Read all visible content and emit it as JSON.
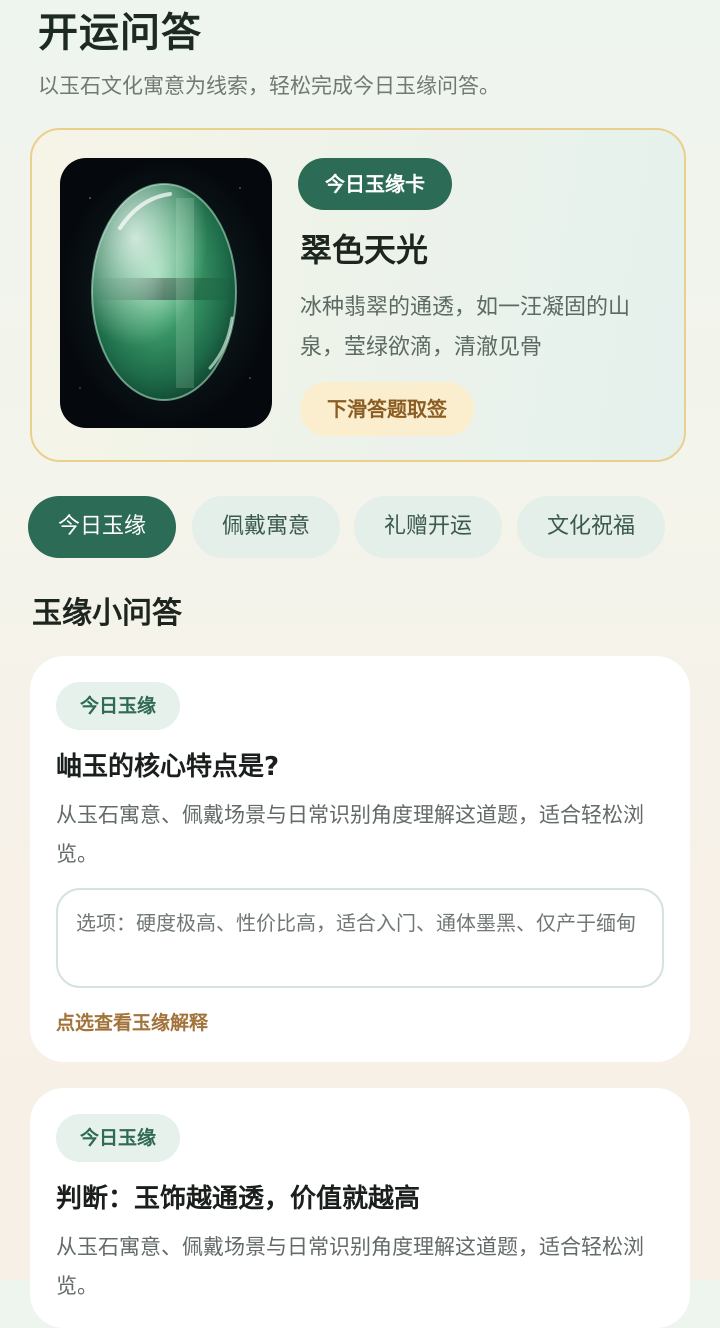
{
  "page": {
    "title": "开运问答",
    "subtitle": "以玉石文化寓意为线索，轻松完成今日玉缘问答。"
  },
  "hero": {
    "badge": "今日玉缘卡",
    "title": "翠色天光",
    "description": "冰种翡翠的通透，如一汪凝固的山泉，莹绿欲滴，清澈见骨",
    "action": "下滑答题取签",
    "image_icon": "jade-cabochon-image"
  },
  "tabs": [
    {
      "label": "今日玉缘",
      "active": true
    },
    {
      "label": "佩戴寓意",
      "active": false
    },
    {
      "label": "礼赠开运",
      "active": false
    },
    {
      "label": "文化祝福",
      "active": false
    }
  ],
  "section": {
    "title": "玉缘小问答"
  },
  "questions": [
    {
      "tag": "今日玉缘",
      "title": "岫玉的核心特点是?",
      "description": "从玉石寓意、佩戴场景与日常识别角度理解这道题，适合轻松浏览。",
      "options": "选项：硬度极高、性价比高，适合入门、通体墨黑、仅产于缅甸",
      "link": "点选查看玉缘解释"
    },
    {
      "tag": "今日玉缘",
      "title": "判断：玉饰越通透，价值就越高",
      "description": "从玉石寓意、佩戴场景与日常识别角度理解这道题，适合轻松浏览。"
    }
  ],
  "colors": {
    "primary": "#2c6b55",
    "accent_gold": "#a2733a",
    "hero_border": "#ead08c",
    "chip_bg": "#e3efe8"
  }
}
